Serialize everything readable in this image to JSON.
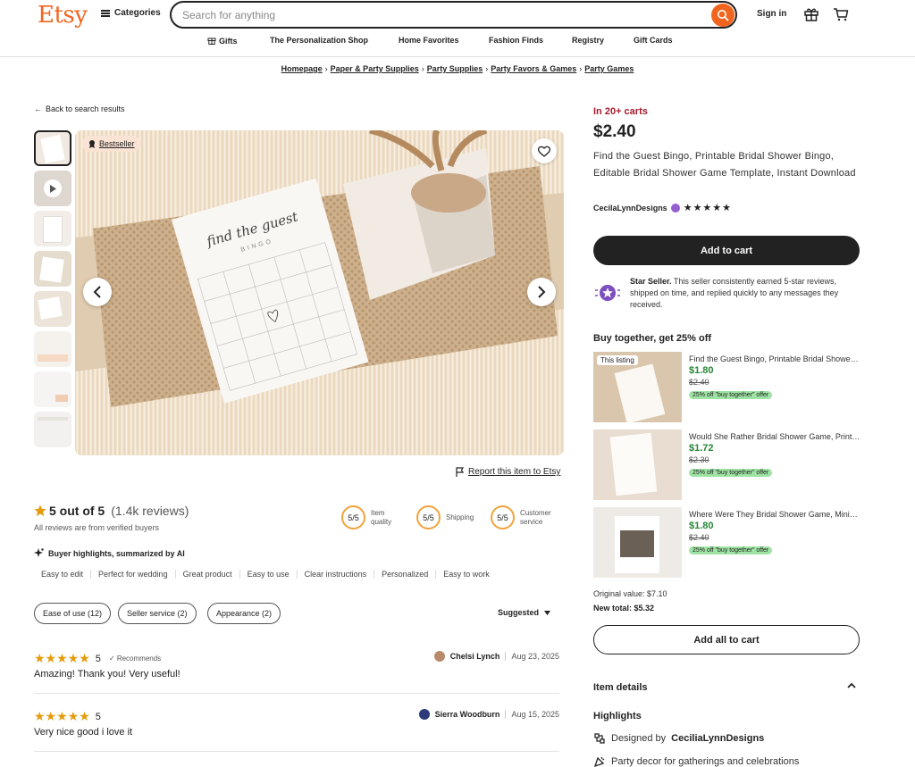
{
  "header": {
    "logo": "Etsy",
    "categories_label": "Categories",
    "search_placeholder": "Search for anything",
    "signin_label": "Sign in",
    "nav": [
      "Gifts",
      "The Personalization Shop",
      "Home Favorites",
      "Fashion Finds",
      "Registry",
      "Gift Cards"
    ]
  },
  "breadcrumb": [
    "Homepage",
    "Paper & Party Supplies",
    "Party Supplies",
    "Party Favors & Games",
    "Party Games"
  ],
  "back_label": "Back to search results",
  "gallery": {
    "badge": "Bestseller",
    "card_title": "find the guest",
    "card_subtitle": "BINGO",
    "report_label": "Report this item to Etsy"
  },
  "reviews": {
    "rating_text": "5 out of 5",
    "count_text": "(1.4k reviews)",
    "verified_note": "All reviews are from verified buyers",
    "scores": [
      {
        "value": "5/5",
        "label": "Item quality"
      },
      {
        "value": "5/5",
        "label": "Shipping"
      },
      {
        "value": "5/5",
        "label": "Customer service"
      }
    ],
    "ai_title": "Buyer highlights, summarized by AI",
    "tags": [
      "Easy to edit",
      "Perfect for wedding",
      "Great product",
      "Easy to use",
      "Clear instructions",
      "Personalized",
      "Easy to work"
    ],
    "filters": [
      "Ease of use (12)",
      "Seller service (2)",
      "Appearance (2)"
    ],
    "sort_label": "Suggested",
    "items": [
      {
        "stars": "5",
        "recommends": "Recommends",
        "author": "Chelsi Lynch",
        "date": "Aug 23, 2025",
        "text": "Amazing! Thank you! Very useful!"
      },
      {
        "stars": "5",
        "recommends": "",
        "author": "Sierra Woodburn",
        "date": "Aug 15, 2025",
        "text": "Very nice good i love it"
      }
    ]
  },
  "product": {
    "carts_note": "In 20+ carts",
    "price": "$2.40",
    "title": "Find the Guest Bingo, Printable Bridal Shower Bingo, Editable Bridal Shower Game Template, Instant Download",
    "shop_name": "CecilaLynnDesigns",
    "add_to_cart_label": "Add to cart",
    "star_seller_bold": "Star Seller.",
    "star_seller_text": "This seller consistently earned 5-star reviews, shipped on time, and replied quickly to any messages they received."
  },
  "buy_together": {
    "title": "Buy together, get 25% off",
    "this_listing_label": "This listing",
    "items": [
      {
        "name": "Find the Guest Bingo, Printable Bridal Shower Bingo, Editable",
        "price": "$1.80",
        "orig": "$2.40",
        "offer": "25% off \"buy together\" offer"
      },
      {
        "name": "Would She Rather Bridal Shower Game, Printable Game",
        "price": "$1.72",
        "orig": "$2.30",
        "offer": "25% off \"buy together\" offer"
      },
      {
        "name": "Where Were They Bridal Shower Game, Minimalist",
        "price": "$1.80",
        "orig": "$2.40",
        "offer": "25% off \"buy together\" offer"
      }
    ],
    "original_value": "Original value: $7.10",
    "new_total": "New total: $5.32",
    "add_all_label": "Add all to cart"
  },
  "details": {
    "item_details_label": "Item details",
    "highlights_label": "Highlights",
    "designed_by_prefix": "Designed by",
    "designed_by_shop": "CeciliaLynnDesigns",
    "party_decor": "Party decor for gatherings and celebrations"
  },
  "colors": {
    "brand": "#f1641e",
    "price_green": "#258635",
    "carts_red": "#a61a2e",
    "star": "#e59b0c"
  }
}
